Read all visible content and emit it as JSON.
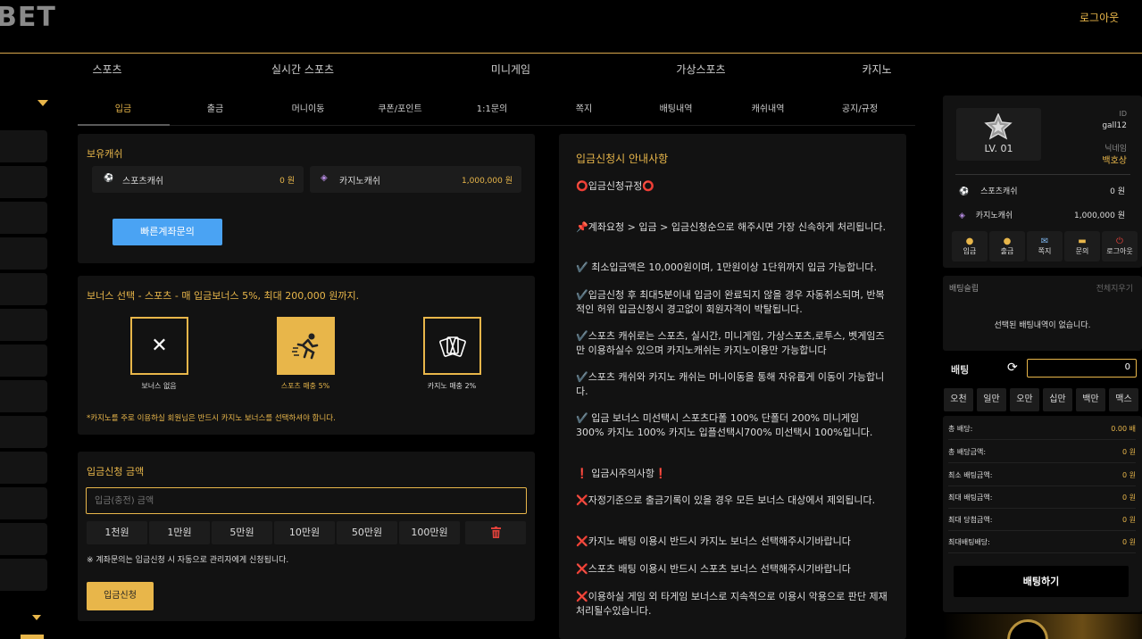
{
  "header": {
    "logo": "BET",
    "logout": "로그아웃"
  },
  "main_nav": [
    "스포츠",
    "실시간 스포츠",
    "미니게임",
    "가상스포츠",
    "카지노"
  ],
  "sub_tabs": [
    "입금",
    "출금",
    "머니이동",
    "쿠폰/포인트",
    "1:1문의",
    "쪽지",
    "배팅내역",
    "캐쉬내역",
    "공지/규정"
  ],
  "wallet": {
    "title": "보유캐쉬",
    "sports_label": "스포츠캐쉬",
    "sports_value": "0 원",
    "casino_label": "카지노캐쉬",
    "casino_value": "1,000,000 원",
    "quick_button": "빠른계좌문의"
  },
  "bonus": {
    "title": "보너스 선택 - 스포츠 - 매 입금보너스 5%, 최대 200,000 원까지.",
    "options": [
      {
        "label": "보너스 없음",
        "icon": "x-icon"
      },
      {
        "label": "스포츠 매충 5%",
        "icon": "runner-icon"
      },
      {
        "label": "카지노 매충 2%",
        "icon": "cards-icon"
      }
    ],
    "note": "*카지노를 주로 이용하실 회원님은 반드시 카지노 보너스를 선택하셔야 합니다."
  },
  "deposit": {
    "title": "입금신청 금액",
    "placeholder": "입금(충전) 금액",
    "amounts": [
      "1천원",
      "1만원",
      "5만원",
      "10만원",
      "50만원",
      "100만원"
    ],
    "note": "※ 계좌문의는 입금신청 시 자동으로 관리자에게 신청됩니다.",
    "submit": "입금신청"
  },
  "notice": {
    "title": "입금신청시 안내사항",
    "lines": [
      "⭕입금신청규정⭕",
      "📌계좌요청 > 입금 > 입금신청순으로 해주시면 가장 신속하게 처리됩니다.",
      "✔️ 최소입금액은 10,000원이며, 1만원이상 1단위까지 입금 가능합니다.",
      "✔️입금신청 후 최대5분이내 입금이 완료되지 않을 경우 자동취소되며, 반복적인 허위 입금신청시 경고없이 회원자격이 박탈됩니다.",
      "✔️스포츠 캐쉬로는 스포츠, 실시간, 미니게임, 가상스포츠,로투스, 벳게임즈만 이용하실수 있으며 카지노캐쉬는 카지노이용만 가능합니다",
      "✔️스포츠 캐쉬와 카지노 캐쉬는 머니이동을 통해 자유롭게 이동이 가능합니다.",
      "✔️ 입금 보너스 미선택시 스포츠다폴 100% 단폴더 200% 미니게임 300% 카지노 100% 카지노 입플선택시700% 미선택시 100%입니다.",
      "❗ 입금시주의사항❗",
      "❌자정기준으로 출금기록이 있을 경우 모든 보너스 대상에서 제외됩니다.",
      "❌카지노 배팅 이용시 반드시 카지노 보너스 선택해주시기바랍니다",
      "❌스포츠 배팅 이용시 반드시 스포츠 보너스 선택해주시기바랍니다",
      "❌이용하실 게임 외 타게임 보너스로 지속적으로 이용시 악용으로 판단 제재처리될수있습니다."
    ]
  },
  "profile": {
    "level": "LV. 01",
    "id_label": "ID",
    "id_value": "gall12",
    "nick_label": "닉네임",
    "nick_value": "백호상",
    "sports_label": "스포츠캐쉬",
    "sports_value": "0 원",
    "casino_label": "카지노캐쉬",
    "casino_value": "1,000,000 원",
    "actions": [
      "입금",
      "출금",
      "쪽지",
      "문의",
      "로그아웃"
    ]
  },
  "betslip": {
    "title": "배팅슬립",
    "clear": "전체지우기",
    "empty": "선택된 배팅내역이 없습니다.",
    "bet_label": "배팅",
    "amount": "0",
    "currency_buttons": [
      "오천",
      "일만",
      "오만",
      "십만",
      "백만",
      "맥스"
    ],
    "stats": [
      {
        "k": "총 배당:",
        "v": "0.00 배"
      },
      {
        "k": "총 배당금액:",
        "v": "0 원"
      },
      {
        "k": "최소 배팅금액:",
        "v": "0 원"
      },
      {
        "k": "최대 배팅금액:",
        "v": "0 원"
      },
      {
        "k": "최대 당첨금액:",
        "v": "0 원"
      },
      {
        "k": "최대배팅배당:",
        "v": "0 원"
      }
    ],
    "submit": "배팅하기"
  },
  "colors": {
    "accent": "#e8b64a",
    "blue": "#4aa3f3",
    "panel": "#121212"
  }
}
